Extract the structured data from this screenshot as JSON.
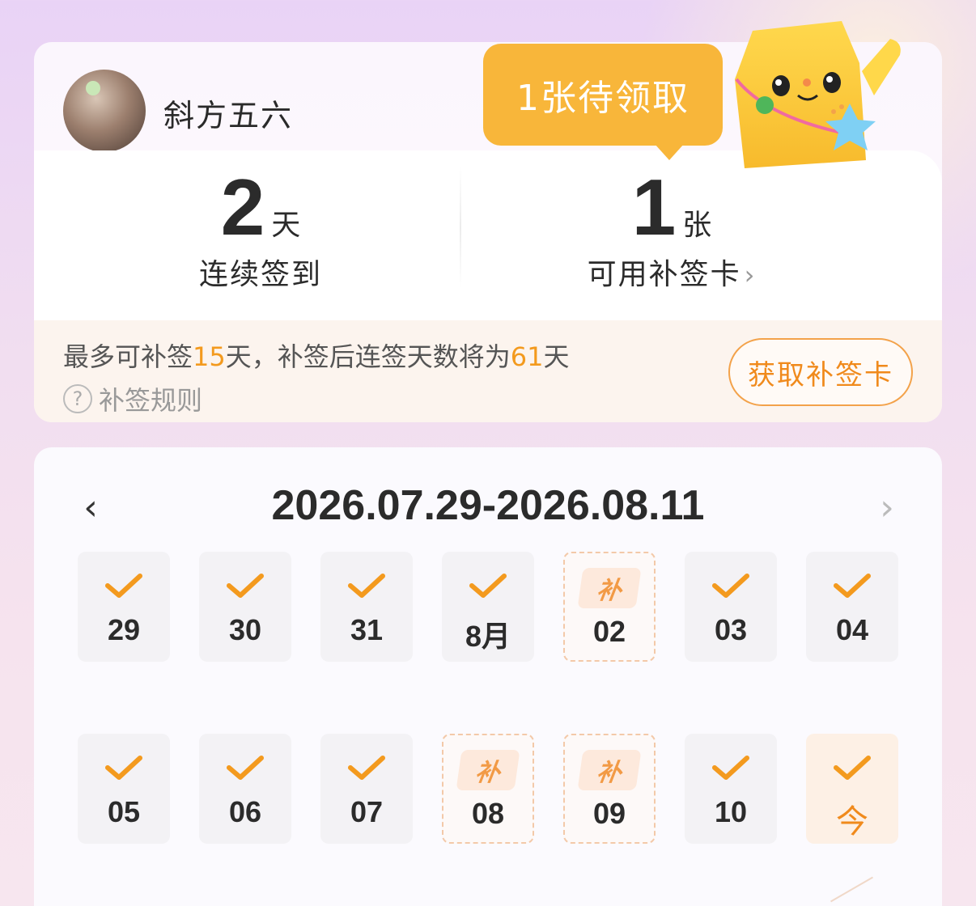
{
  "user": {
    "name": "斜方五六"
  },
  "tooltip": {
    "text": "1张待领取"
  },
  "stats": {
    "streak": {
      "value": "2",
      "unit": "天",
      "label": "连续签到"
    },
    "cards": {
      "value": "1",
      "unit": "张",
      "label": "可用补签卡",
      "chevron": "›"
    }
  },
  "makeup": {
    "text_prefix": "最多可补签",
    "max_days": "15",
    "text_mid": "天，补签后连签天数将为",
    "result_days": "61",
    "text_suffix": "天",
    "rules_icon": "?",
    "rules_label": "补签规则",
    "get_card_button": "获取补签卡"
  },
  "calendar": {
    "prev": "‹",
    "next": "›",
    "range": "2026.07.29-2026.08.11",
    "days": [
      {
        "label": "29",
        "state": "checked"
      },
      {
        "label": "30",
        "state": "checked"
      },
      {
        "label": "31",
        "state": "checked"
      },
      {
        "label": "8月",
        "state": "checked"
      },
      {
        "label": "02",
        "state": "makeup",
        "tag": "补"
      },
      {
        "label": "03",
        "state": "checked"
      },
      {
        "label": "04",
        "state": "checked"
      },
      {
        "label": "05",
        "state": "checked"
      },
      {
        "label": "06",
        "state": "checked"
      },
      {
        "label": "07",
        "state": "checked"
      },
      {
        "label": "08",
        "state": "makeup",
        "tag": "补"
      },
      {
        "label": "09",
        "state": "makeup",
        "tag": "补"
      },
      {
        "label": "10",
        "state": "checked"
      },
      {
        "label": "今",
        "state": "today"
      }
    ]
  },
  "colors": {
    "accent": "#f08a1c",
    "tooltip": "#f8b63a",
    "check": "#f39a1e"
  }
}
